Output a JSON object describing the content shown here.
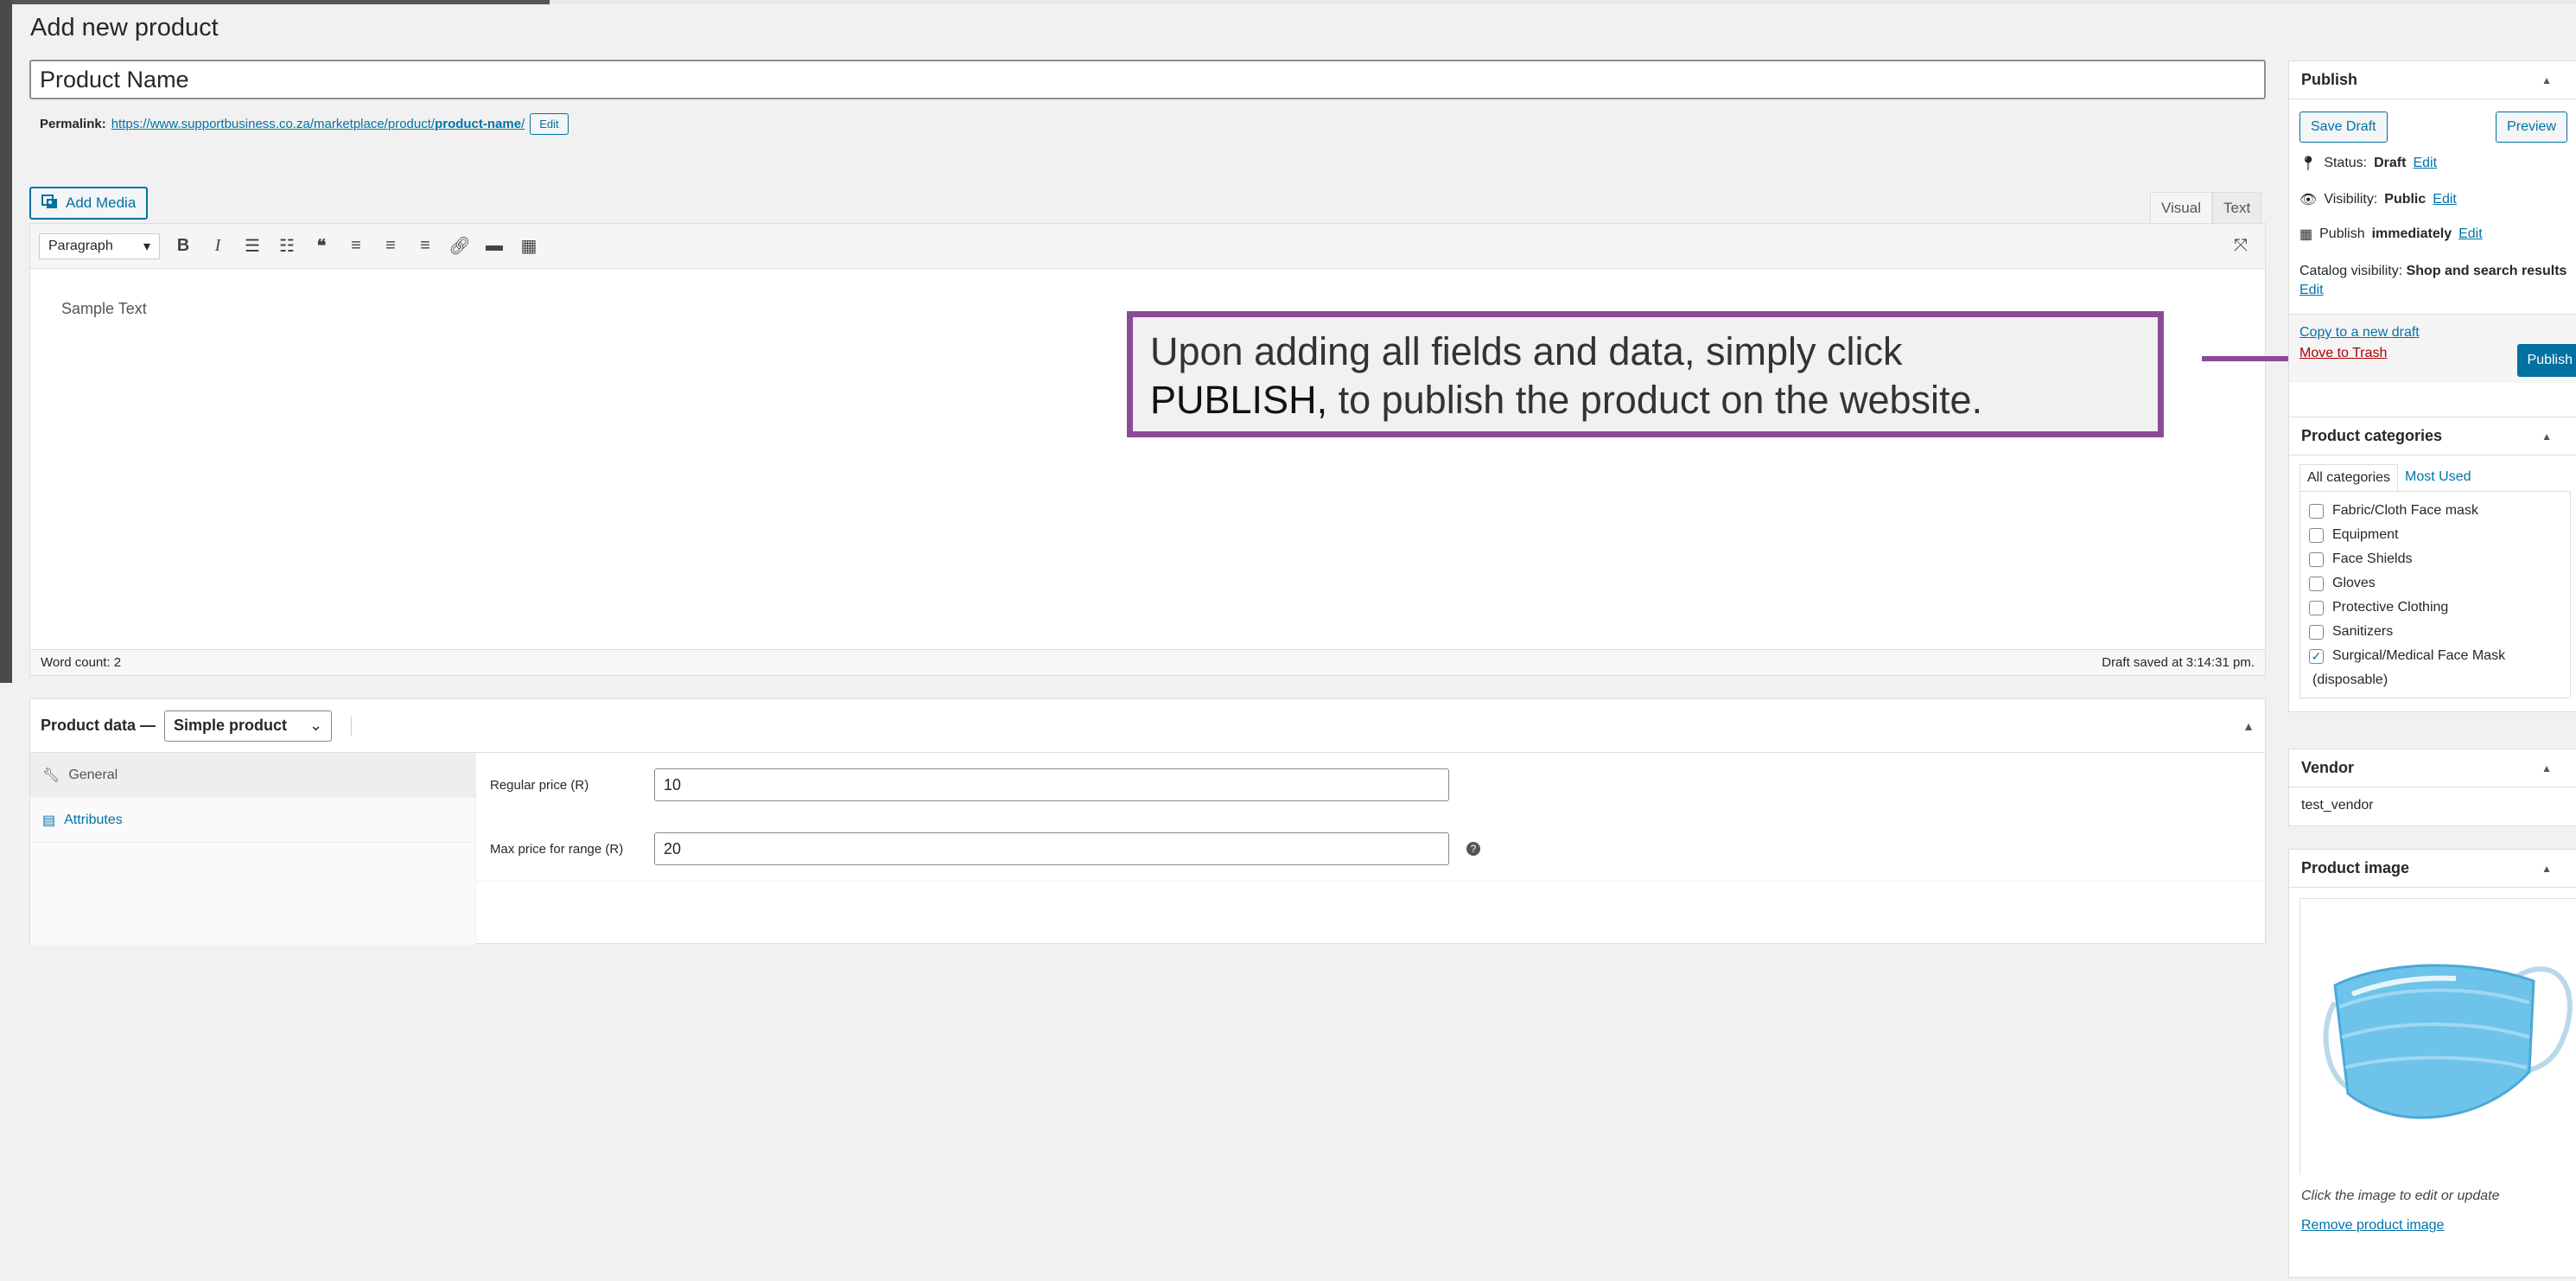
{
  "page": {
    "title": "Add new product"
  },
  "product": {
    "name": "Product Name"
  },
  "permalink": {
    "label": "Permalink:",
    "url_prefix": "https://www.supportbusiness.co.za/marketplace/product/",
    "slug": "product-name",
    "url_suffix": "/",
    "edit_label": "Edit"
  },
  "editor": {
    "add_media_label": "Add Media",
    "tab_visual": "Visual",
    "tab_text": "Text",
    "format_selected": "Paragraph",
    "content": "Sample Text",
    "word_count": "Word count: 2",
    "draft_saved": "Draft saved at 3:14:31 pm."
  },
  "callout": {
    "text_before": "Upon adding all fields and data, simply click",
    "emphasis": "PUBLISH,",
    "text_after": "to publish the product on the website.",
    "border_color": "#8b4a98",
    "arrow_color": "#8b4a98"
  },
  "product_data": {
    "label": "Product data —",
    "type_selected": "Simple product",
    "tabs": [
      {
        "label": "General",
        "icon": "wrench-icon"
      },
      {
        "label": "Attributes",
        "icon": "table-icon"
      }
    ],
    "fields": [
      {
        "label": "Regular price (R)",
        "value": "10"
      },
      {
        "label": "Max price for range (R)",
        "value": "20"
      }
    ]
  },
  "publish": {
    "title": "Publish",
    "save_draft": "Save Draft",
    "preview": "Preview",
    "status_label": "Status:",
    "status_value": "Draft",
    "visibility_label": "Visibility:",
    "visibility_value": "Public",
    "publish_label": "Publish",
    "publish_value": "immediately",
    "edit": "Edit",
    "catalog_label": "Catalog visibility:",
    "catalog_value": "Shop and search results",
    "copy_draft": "Copy to a new draft",
    "trash": "Move to Trash",
    "publish_button": "Publish",
    "accent": "#0071a1"
  },
  "categories": {
    "title": "Product categories",
    "tab_all": "All categories",
    "tab_used": "Most Used",
    "items": [
      {
        "label": "Fabric/Cloth Face mask",
        "checked": false
      },
      {
        "label": "Equipment",
        "checked": false
      },
      {
        "label": "Face Shields",
        "checked": false
      },
      {
        "label": "Gloves",
        "checked": false
      },
      {
        "label": "Protective Clothing",
        "checked": false
      },
      {
        "label": "Sanitizers",
        "checked": false
      },
      {
        "label": "Surgical/Medical Face Mask",
        "checked": true
      }
    ],
    "extra_line": "(disposable)"
  },
  "vendor": {
    "title": "Vendor",
    "value": "test_vendor"
  },
  "product_image": {
    "title": "Product image",
    "caption": "Click the image to edit or update",
    "remove": "Remove product image"
  }
}
